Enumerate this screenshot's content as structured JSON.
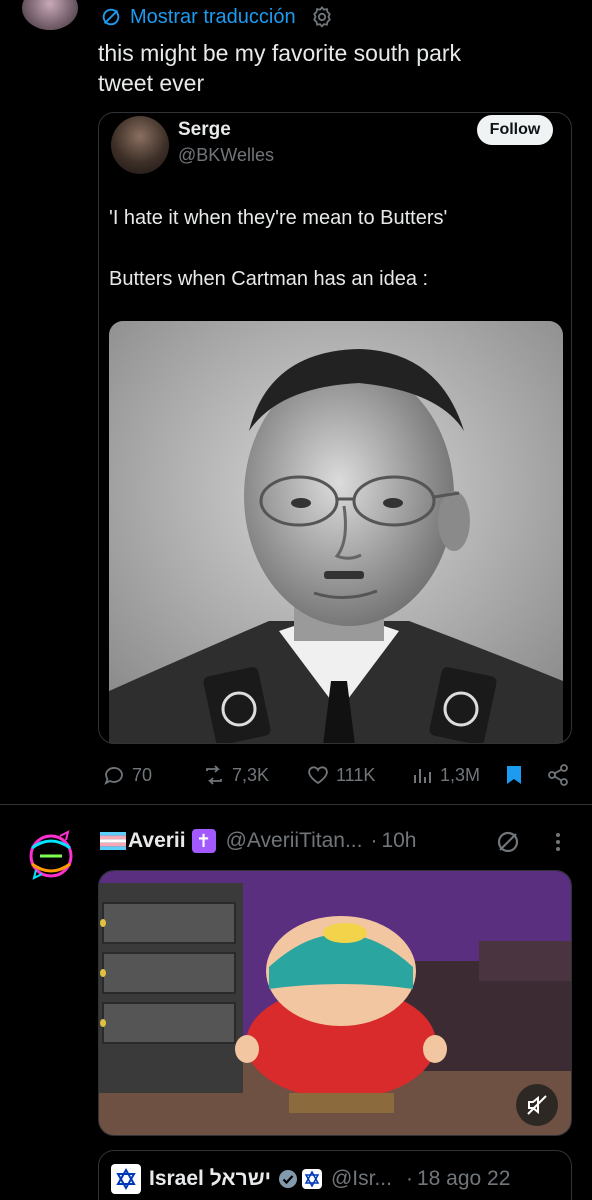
{
  "tweet": {
    "translate_label": "Mostrar traducción",
    "text_line1": "this might be my favorite south park",
    "text_line2": "tweet ever"
  },
  "quoted": {
    "name": "Serge",
    "handle": "@BKWelles",
    "follow_label": "Follow",
    "line1": "'I hate it when they're mean to Butters'",
    "line2": "Butters when Cartman has an idea :"
  },
  "actions": {
    "replies": "70",
    "reposts": "7,3K",
    "likes": "111K",
    "views": "1,3M"
  },
  "tweet2": {
    "name": "Averii",
    "handle": "@AveriiTitan...",
    "dot": "·",
    "time": "10h"
  },
  "quote2": {
    "name": "Israel ישראל",
    "handle": "@Isr...",
    "dot": "·",
    "time": "18 ago 22"
  },
  "colors": {
    "background": "#000000",
    "accent": "#1d9bf0",
    "muted": "#71767b",
    "text": "#e7e9ea",
    "border": "#2f3336"
  }
}
